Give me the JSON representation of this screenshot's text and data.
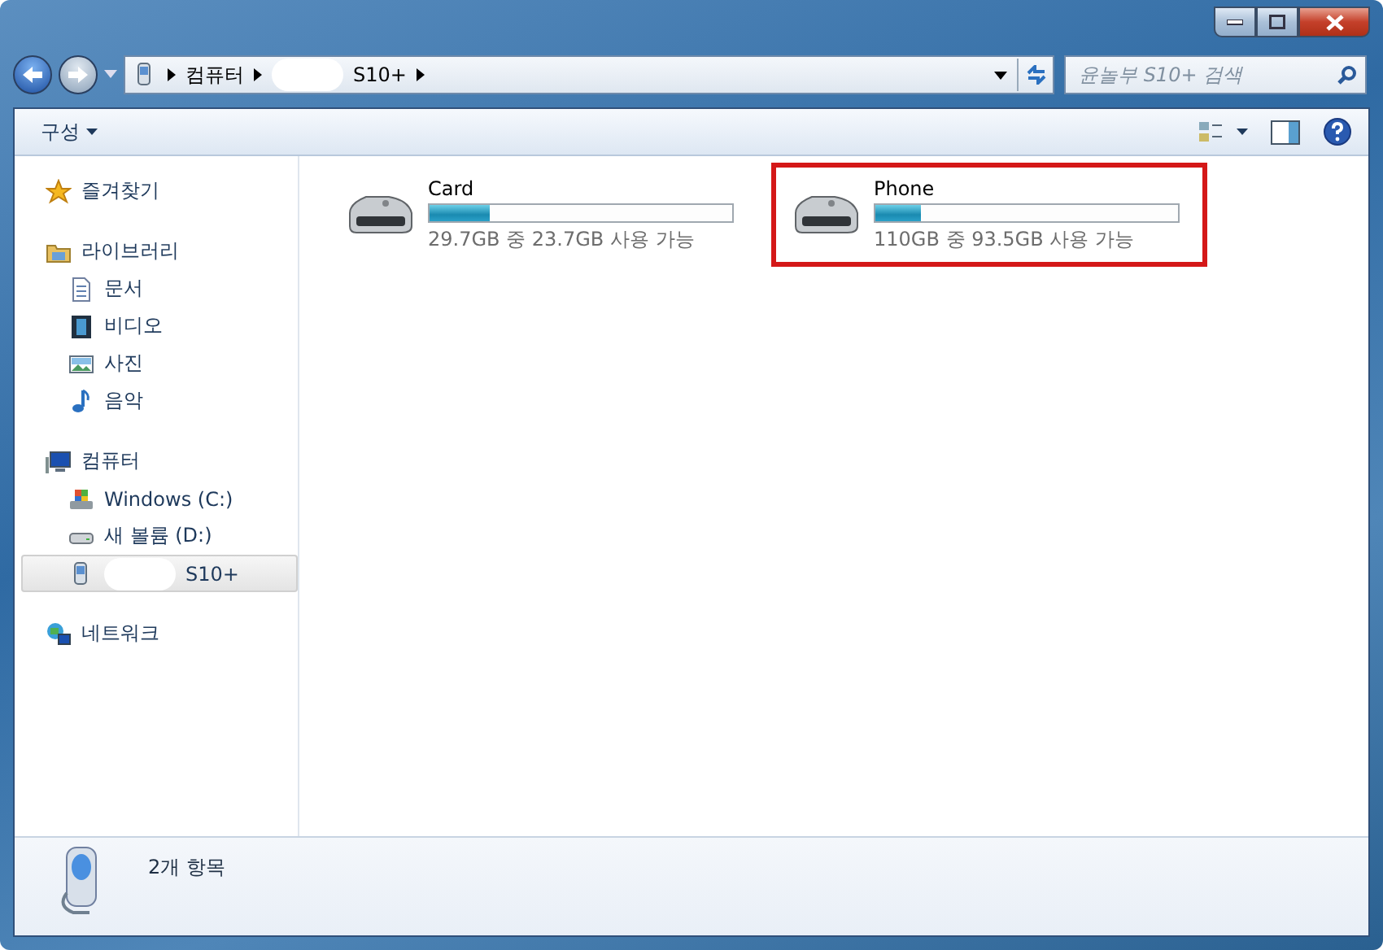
{
  "address": {
    "crumbs": [
      {
        "kind": "text",
        "label": "컴퓨터"
      },
      {
        "kind": "redacted",
        "label": "S10+"
      }
    ]
  },
  "search": {
    "placeholder": "윤놀부 S10+ 검색"
  },
  "toolbar": {
    "organize": "구성"
  },
  "sidebar": [
    {
      "label": "즐겨찾기"
    },
    {
      "label": "라이브러리",
      "children": [
        {
          "label": "문서",
          "selected": false
        },
        {
          "label": "비디오",
          "selected": false
        },
        {
          "label": "사진",
          "selected": false
        },
        {
          "label": "음악",
          "selected": false
        }
      ]
    },
    {
      "label": "컴퓨터",
      "children": [
        {
          "label": "Windows  (C:)",
          "selected": false
        },
        {
          "label": "새 볼륨 (D:)",
          "selected": false
        },
        {
          "label": "S10+",
          "redacted": true,
          "selected": true
        }
      ]
    },
    {
      "label": "네트워크"
    }
  ],
  "drives": [
    {
      "name": "Card",
      "level": 0.2,
      "space": "29.7GB 중 23.7GB 사용 가능",
      "highlighted": false
    },
    {
      "name": "Phone",
      "level": 0.15,
      "space": "110GB 중 93.5GB 사용 가능",
      "highlighted": true
    }
  ],
  "status_bar": {
    "count": "2개 항목"
  }
}
